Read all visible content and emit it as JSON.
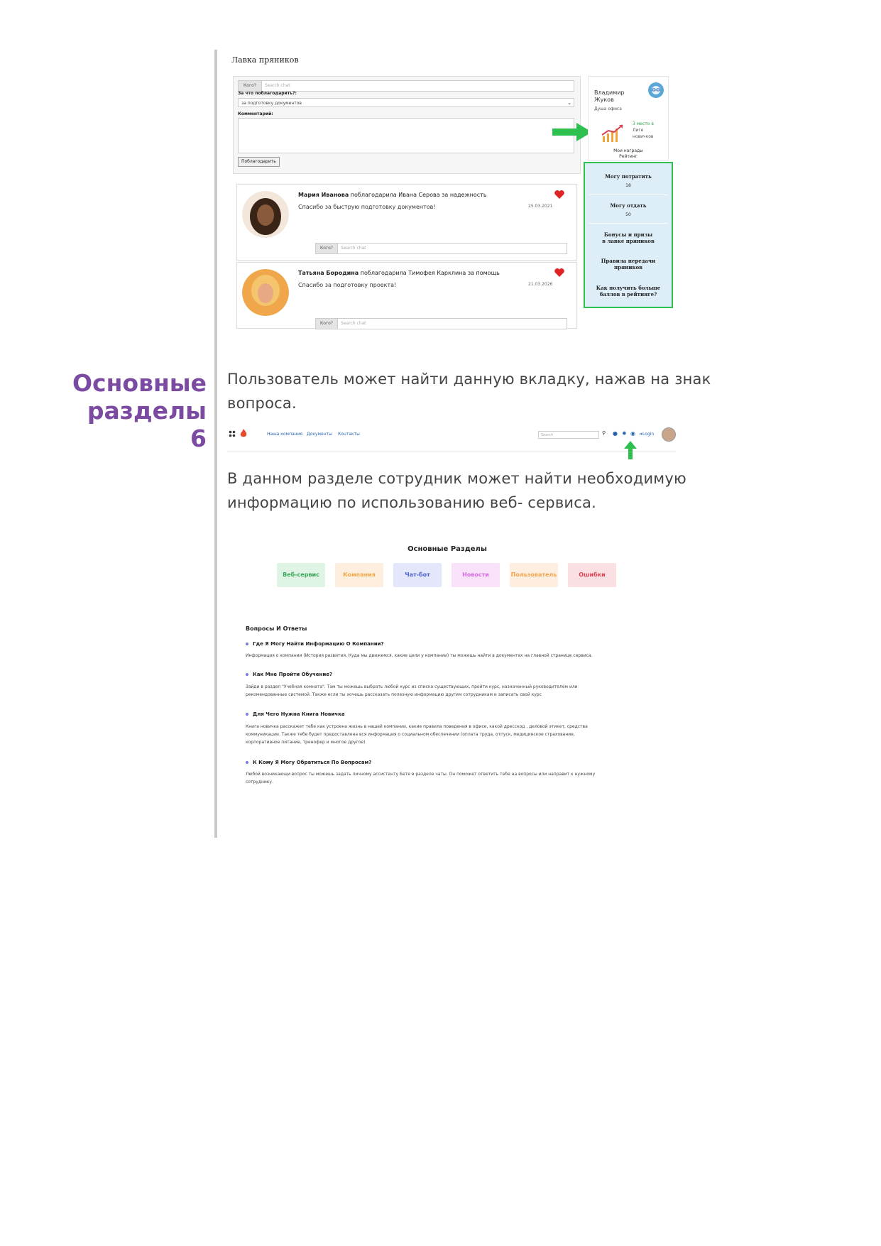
{
  "section": {
    "heading_line1": "Основные",
    "heading_line2": "разделы",
    "number": "6"
  },
  "shot1": {
    "title": "Лавка пряников",
    "whom_addon": "Кого?",
    "search_placeholder": "Search chat",
    "reason_label": "За что поблагодарить?:",
    "reason_value": "за подготовку документов",
    "comment_label": "Комментарий:",
    "thank_button": "Поблагодарить",
    "profile": {
      "name_line1": "Владимир",
      "name_line2": "Жуков",
      "role": "Душа офиса",
      "place_hl": "3 место в",
      "place_rest1": "Лиге",
      "place_rest2": "новичков",
      "awards": "Мои награды",
      "rating": "Рейтинг"
    },
    "menu": {
      "can_spend_label": "Могу потратить",
      "can_spend_value": "18",
      "can_give_label": "Могу отдать",
      "can_give_value": "50",
      "bonuses_line1": "Бонусы и призы",
      "bonuses_line2": "в лавке пряников",
      "rules_line1": "Правила передачи",
      "rules_line2": "пряников",
      "more_line1": "Как получить больше",
      "more_line2": "баллов в рейтинге?"
    },
    "posts": [
      {
        "author": "Мария Иванова",
        "action": " поблагодарила Ивана Серова за надежность",
        "message": "Спасибо за быструю подготовку документов!",
        "date": "25.03.2021",
        "whom": "Кого?",
        "search": "Search chat"
      },
      {
        "author": "Татьяна Бородина",
        "action": " поблагодарила Тимофея Карклина за помощь",
        "message": "Спасибо за подготовку проекта!",
        "date": "21.03.2026",
        "whom": "Кого?",
        "search": "Search chat"
      }
    ]
  },
  "text": {
    "para1_line1": "Пользователь может найти данную вкладку, нажав на знак",
    "para1_line2": "вопроса.",
    "para2_line1": "В данном разделе сотрудник может найти необходимую",
    "para2_line2": "информацию по использованию веб- сервиса."
  },
  "navbar": {
    "links": [
      "Наша компания",
      "Документы",
      "Контакты"
    ],
    "search_placeholder": "Search",
    "login": "Login"
  },
  "shot3": {
    "title": "Основные Разделы",
    "categories": [
      {
        "label": "Веб-сервис",
        "color": "#3aa657",
        "bg": "#dff4e4"
      },
      {
        "label": "Компания",
        "color": "#f3a94a",
        "bg": "#fdeede"
      },
      {
        "label": "Чат-бот",
        "color": "#4b64c8",
        "bg": "#e4e6fb"
      },
      {
        "label": "Новости",
        "color": "#d56ee0",
        "bg": "#f9e1fa"
      },
      {
        "label": "Пользователь",
        "color": "#f0a54e",
        "bg": "#fdeedf"
      },
      {
        "label": "Ошибки",
        "color": "#d94454",
        "bg": "#fbe0e3"
      }
    ],
    "qa_title": "Вопросы И Ответы",
    "qa": [
      {
        "q": "Где Я Могу Найти Информацию О Компании?",
        "a": [
          "Информация о компании (История развития, Куда мы движемся, какие цели у компании) ты можешь найти в документах на главной странице сервиса."
        ]
      },
      {
        "q": "Как Мне Пройти Обучение?",
        "a": [
          "Зайди в раздел \"Учебная комната\". Там ты можешь выбрать любой курс из списка существующих, пройти курс, назначенный руководителем или",
          "рекомендованные системой. Также если ты хочешь рассказать полезную информацию другим сотрудникам и записать свой курс"
        ]
      },
      {
        "q": "Для Чего Нужна Книга Новичка",
        "a": [
          "Книга новичка расскажет тебе как устроена жизнь в нашей компании, какие правила поведения в офисе, какой дресскод , деловой этикет, средства",
          "коммуникации. Также тебе будет предоставлена вся информация о социальном обеспечении (оплата труда, отпуск, медицинское страхование,",
          "корпоративное питание, тренофер и многое другое)"
        ]
      },
      {
        "q": "К Кому Я Могу Обратиться По Вопросам?",
        "a": [
          "Любой возникающи вопрос ты можешь задать личному ассистенту Бете в разделе чаты. Он поможет ответить тебе на вопросы или направит к нужному",
          "сотруднику."
        ]
      }
    ]
  },
  "colors": {
    "heading": "#7b4aa1",
    "green_highlight": "#2ec04f",
    "link": "#2a65b0"
  }
}
